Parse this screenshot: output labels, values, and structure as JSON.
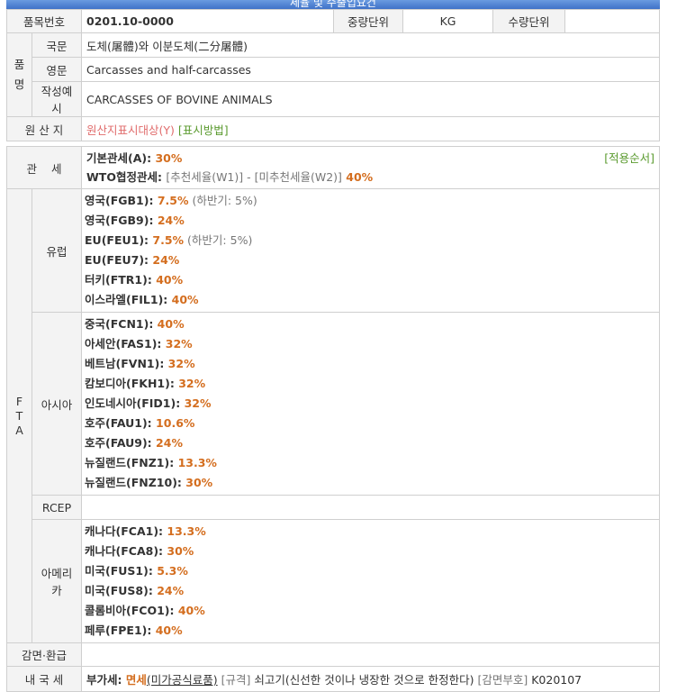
{
  "title": "세율 및 수출입요건",
  "header": {
    "item_no_label": "품목번호",
    "item_no": "0201.10-0000",
    "weight_unit_label": "중량단위",
    "weight_unit": "KG",
    "qty_unit_label": "수량단위",
    "qty_unit": ""
  },
  "name": {
    "group_label": "품\n명",
    "kor_label": "국문",
    "kor_value": "도체(屠體)와 이분도체(二分屠體)",
    "eng_label": "영문",
    "eng_value": "Carcasses and half-carcasses",
    "example_label": "작성예시",
    "example_value": "CARCASSES OF BOVINE ANIMALS"
  },
  "origin": {
    "label": "원 산 지",
    "target_link": "원산지표시대상(Y)",
    "method_link": "[표시방법]"
  },
  "tariff": {
    "label": "관    세",
    "basic_label": "기본관세(A): ",
    "basic_rate": "30%",
    "wto_label": "WTO협정관세: ",
    "wto_rec": "[추천세율(W1)]",
    "wto_sep": " - ",
    "wto_nonrec": "[미추천세율(W2)]",
    "wto_rate": " 40%",
    "order_link": "[적용순서]"
  },
  "fta": {
    "label": "F\nT\nA",
    "groups": [
      {
        "name": "유럽",
        "items": [
          {
            "code": "영국(FGB1): ",
            "rate": "7.5%",
            "note": " (하반기: 5%)"
          },
          {
            "code": "영국(FGB9): ",
            "rate": "24%",
            "note": ""
          },
          {
            "code": "EU(FEU1): ",
            "rate": "7.5%",
            "note": " (하반기: 5%)"
          },
          {
            "code": "EU(FEU7): ",
            "rate": "24%",
            "note": ""
          },
          {
            "code": "터키(FTR1): ",
            "rate": "40%",
            "note": ""
          },
          {
            "code": "이스라엘(FIL1): ",
            "rate": "40%",
            "note": ""
          }
        ]
      },
      {
        "name": "아시아",
        "items": [
          {
            "code": "중국(FCN1): ",
            "rate": "40%",
            "note": ""
          },
          {
            "code": "아세안(FAS1): ",
            "rate": "32%",
            "note": ""
          },
          {
            "code": "베트남(FVN1): ",
            "rate": "32%",
            "note": ""
          },
          {
            "code": "캄보디아(FKH1): ",
            "rate": "32%",
            "note": ""
          },
          {
            "code": "인도네시아(FID1): ",
            "rate": "32%",
            "note": ""
          },
          {
            "code": "호주(FAU1): ",
            "rate": "10.6%",
            "note": ""
          },
          {
            "code": "호주(FAU9): ",
            "rate": "24%",
            "note": ""
          },
          {
            "code": "뉴질랜드(FNZ1): ",
            "rate": "13.3%",
            "note": ""
          },
          {
            "code": "뉴질랜드(FNZ10): ",
            "rate": "30%",
            "note": ""
          }
        ]
      },
      {
        "name": "RCEP",
        "items": []
      },
      {
        "name": "아메리카",
        "items": [
          {
            "code": "캐나다(FCA1): ",
            "rate": "13.3%",
            "note": ""
          },
          {
            "code": "캐나다(FCA8): ",
            "rate": "30%",
            "note": ""
          },
          {
            "code": "미국(FUS1): ",
            "rate": "5.3%",
            "note": ""
          },
          {
            "code": "미국(FUS8): ",
            "rate": "24%",
            "note": ""
          },
          {
            "code": "콜롬비아(FCO1): ",
            "rate": "40%",
            "note": ""
          },
          {
            "code": "페루(FPE1): ",
            "rate": "40%",
            "note": ""
          }
        ]
      }
    ]
  },
  "reduction": {
    "label": "감면·환급",
    "value": ""
  },
  "domestic": {
    "label": "내 국 세",
    "vat_label": "부가세: ",
    "vat_value": "면세",
    "vat_link": "(미가공식료품)",
    "spec_label": " [규격] ",
    "spec_value": "쇠고기(신선한 것이나 냉장한 것으로 한정한다)",
    "code_label": " [감면부호] ",
    "code_value": "K020107"
  },
  "colors": {
    "rate": "#d46e1f",
    "origin_target": "#e06b6b",
    "link_green": "#5a9a2e",
    "title_bar": "#3f72c8"
  }
}
